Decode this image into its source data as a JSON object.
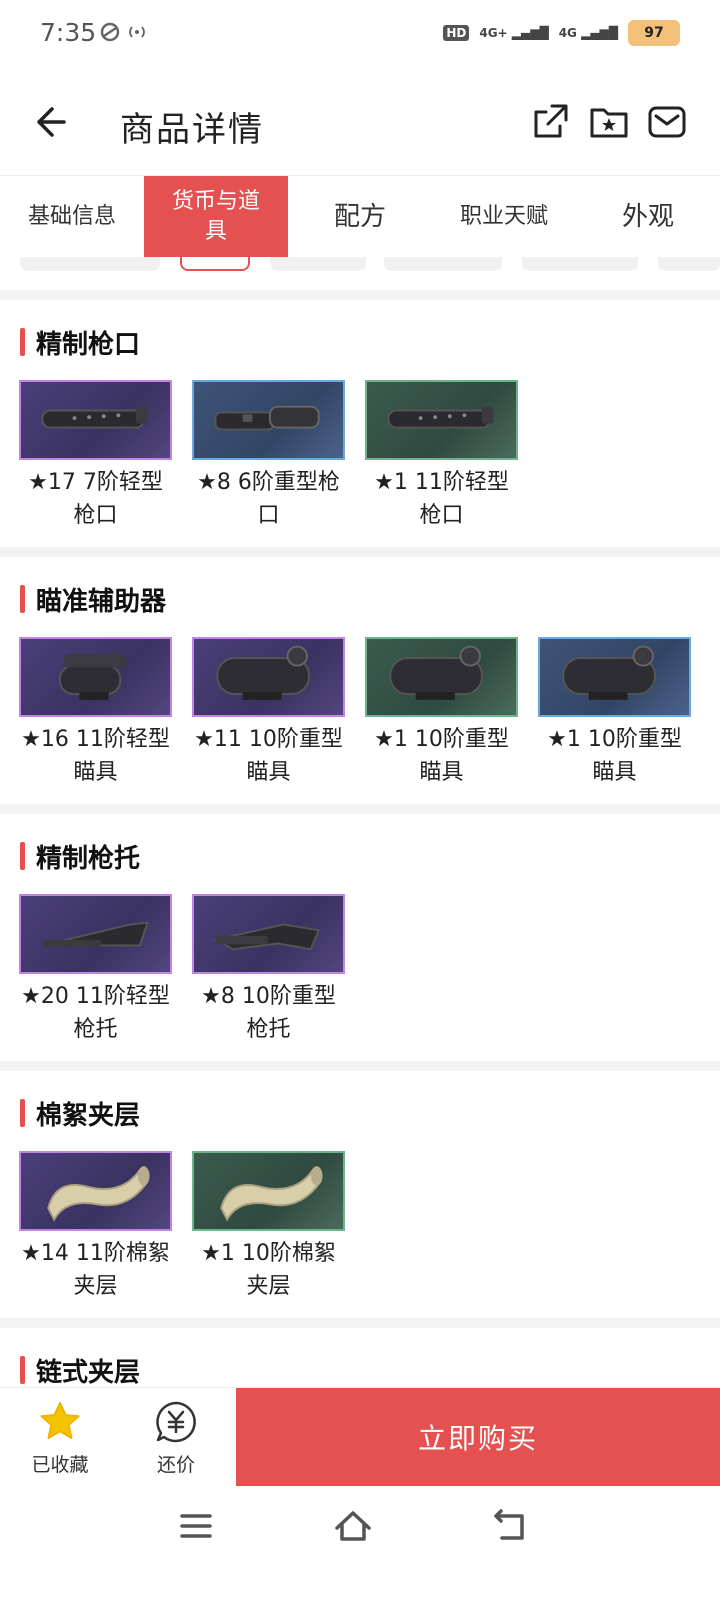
{
  "status": {
    "time": "7:35",
    "network1": "4G+",
    "network2": "4G",
    "hd": "HD",
    "battery": "97"
  },
  "header": {
    "title": "商品详情"
  },
  "tabs": [
    {
      "label": "基础信息",
      "active": false
    },
    {
      "label": "货币与道具",
      "active": true
    },
    {
      "label": "配方",
      "active": false
    },
    {
      "label": "职业天赋",
      "active": false
    },
    {
      "label": "外观",
      "active": false
    }
  ],
  "sections": [
    {
      "title": "精制枪口",
      "items": [
        {
          "label": "★17 7阶轻型枪口",
          "rarity": "purple",
          "icon": "muzzle"
        },
        {
          "label": "★8 6阶重型枪口",
          "rarity": "blue",
          "icon": "muzzle-heavy"
        },
        {
          "label": "★1 11阶轻型枪口",
          "rarity": "green",
          "icon": "muzzle"
        }
      ]
    },
    {
      "title": "瞄准辅助器",
      "items": [
        {
          "label": "★16 11阶轻型瞄具",
          "rarity": "purple",
          "icon": "scope-light"
        },
        {
          "label": "★11 10阶重型瞄具",
          "rarity": "purple",
          "icon": "scope"
        },
        {
          "label": "★1 10阶重型瞄具",
          "rarity": "green",
          "icon": "scope"
        },
        {
          "label": "★1 10阶重型瞄具",
          "rarity": "blue",
          "icon": "scope"
        }
      ]
    },
    {
      "title": "精制枪托",
      "items": [
        {
          "label": "★20 11阶轻型枪托",
          "rarity": "purple",
          "icon": "stock"
        },
        {
          "label": "★8 10阶重型枪托",
          "rarity": "purple",
          "icon": "stock-heavy"
        }
      ]
    },
    {
      "title": "棉絮夹层",
      "items": [
        {
          "label": "★14 11阶棉絮夹层",
          "rarity": "purple",
          "icon": "fabric"
        },
        {
          "label": "★1 10阶棉絮夹层",
          "rarity": "green",
          "icon": "fabric"
        }
      ]
    },
    {
      "title": "链式夹层",
      "items": []
    }
  ],
  "bottom": {
    "favorite_label": "已收藏",
    "bargain_label": "还价",
    "buy_label": "立即购买"
  },
  "colors": {
    "accent": "#e55050",
    "favorite": "#f5c400"
  }
}
